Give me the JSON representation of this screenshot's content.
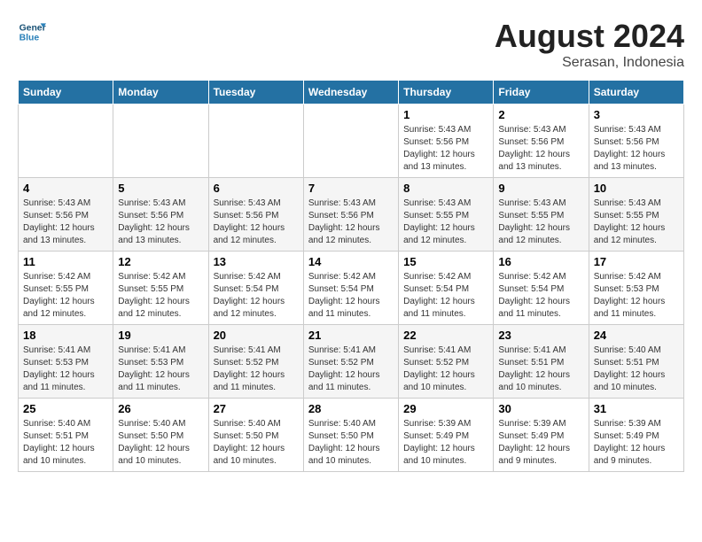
{
  "header": {
    "logo_line1": "General",
    "logo_line2": "Blue",
    "month_year": "August 2024",
    "location": "Serasan, Indonesia"
  },
  "weekdays": [
    "Sunday",
    "Monday",
    "Tuesday",
    "Wednesday",
    "Thursday",
    "Friday",
    "Saturday"
  ],
  "weeks": [
    [
      {
        "day": "",
        "info": ""
      },
      {
        "day": "",
        "info": ""
      },
      {
        "day": "",
        "info": ""
      },
      {
        "day": "",
        "info": ""
      },
      {
        "day": "1",
        "info": "Sunrise: 5:43 AM\nSunset: 5:56 PM\nDaylight: 12 hours\nand 13 minutes."
      },
      {
        "day": "2",
        "info": "Sunrise: 5:43 AM\nSunset: 5:56 PM\nDaylight: 12 hours\nand 13 minutes."
      },
      {
        "day": "3",
        "info": "Sunrise: 5:43 AM\nSunset: 5:56 PM\nDaylight: 12 hours\nand 13 minutes."
      }
    ],
    [
      {
        "day": "4",
        "info": "Sunrise: 5:43 AM\nSunset: 5:56 PM\nDaylight: 12 hours\nand 13 minutes."
      },
      {
        "day": "5",
        "info": "Sunrise: 5:43 AM\nSunset: 5:56 PM\nDaylight: 12 hours\nand 13 minutes."
      },
      {
        "day": "6",
        "info": "Sunrise: 5:43 AM\nSunset: 5:56 PM\nDaylight: 12 hours\nand 12 minutes."
      },
      {
        "day": "7",
        "info": "Sunrise: 5:43 AM\nSunset: 5:56 PM\nDaylight: 12 hours\nand 12 minutes."
      },
      {
        "day": "8",
        "info": "Sunrise: 5:43 AM\nSunset: 5:55 PM\nDaylight: 12 hours\nand 12 minutes."
      },
      {
        "day": "9",
        "info": "Sunrise: 5:43 AM\nSunset: 5:55 PM\nDaylight: 12 hours\nand 12 minutes."
      },
      {
        "day": "10",
        "info": "Sunrise: 5:43 AM\nSunset: 5:55 PM\nDaylight: 12 hours\nand 12 minutes."
      }
    ],
    [
      {
        "day": "11",
        "info": "Sunrise: 5:42 AM\nSunset: 5:55 PM\nDaylight: 12 hours\nand 12 minutes."
      },
      {
        "day": "12",
        "info": "Sunrise: 5:42 AM\nSunset: 5:55 PM\nDaylight: 12 hours\nand 12 minutes."
      },
      {
        "day": "13",
        "info": "Sunrise: 5:42 AM\nSunset: 5:54 PM\nDaylight: 12 hours\nand 12 minutes."
      },
      {
        "day": "14",
        "info": "Sunrise: 5:42 AM\nSunset: 5:54 PM\nDaylight: 12 hours\nand 11 minutes."
      },
      {
        "day": "15",
        "info": "Sunrise: 5:42 AM\nSunset: 5:54 PM\nDaylight: 12 hours\nand 11 minutes."
      },
      {
        "day": "16",
        "info": "Sunrise: 5:42 AM\nSunset: 5:54 PM\nDaylight: 12 hours\nand 11 minutes."
      },
      {
        "day": "17",
        "info": "Sunrise: 5:42 AM\nSunset: 5:53 PM\nDaylight: 12 hours\nand 11 minutes."
      }
    ],
    [
      {
        "day": "18",
        "info": "Sunrise: 5:41 AM\nSunset: 5:53 PM\nDaylight: 12 hours\nand 11 minutes."
      },
      {
        "day": "19",
        "info": "Sunrise: 5:41 AM\nSunset: 5:53 PM\nDaylight: 12 hours\nand 11 minutes."
      },
      {
        "day": "20",
        "info": "Sunrise: 5:41 AM\nSunset: 5:52 PM\nDaylight: 12 hours\nand 11 minutes."
      },
      {
        "day": "21",
        "info": "Sunrise: 5:41 AM\nSunset: 5:52 PM\nDaylight: 12 hours\nand 11 minutes."
      },
      {
        "day": "22",
        "info": "Sunrise: 5:41 AM\nSunset: 5:52 PM\nDaylight: 12 hours\nand 10 minutes."
      },
      {
        "day": "23",
        "info": "Sunrise: 5:41 AM\nSunset: 5:51 PM\nDaylight: 12 hours\nand 10 minutes."
      },
      {
        "day": "24",
        "info": "Sunrise: 5:40 AM\nSunset: 5:51 PM\nDaylight: 12 hours\nand 10 minutes."
      }
    ],
    [
      {
        "day": "25",
        "info": "Sunrise: 5:40 AM\nSunset: 5:51 PM\nDaylight: 12 hours\nand 10 minutes."
      },
      {
        "day": "26",
        "info": "Sunrise: 5:40 AM\nSunset: 5:50 PM\nDaylight: 12 hours\nand 10 minutes."
      },
      {
        "day": "27",
        "info": "Sunrise: 5:40 AM\nSunset: 5:50 PM\nDaylight: 12 hours\nand 10 minutes."
      },
      {
        "day": "28",
        "info": "Sunrise: 5:40 AM\nSunset: 5:50 PM\nDaylight: 12 hours\nand 10 minutes."
      },
      {
        "day": "29",
        "info": "Sunrise: 5:39 AM\nSunset: 5:49 PM\nDaylight: 12 hours\nand 10 minutes."
      },
      {
        "day": "30",
        "info": "Sunrise: 5:39 AM\nSunset: 5:49 PM\nDaylight: 12 hours\nand 9 minutes."
      },
      {
        "day": "31",
        "info": "Sunrise: 5:39 AM\nSunset: 5:49 PM\nDaylight: 12 hours\nand 9 minutes."
      }
    ]
  ]
}
